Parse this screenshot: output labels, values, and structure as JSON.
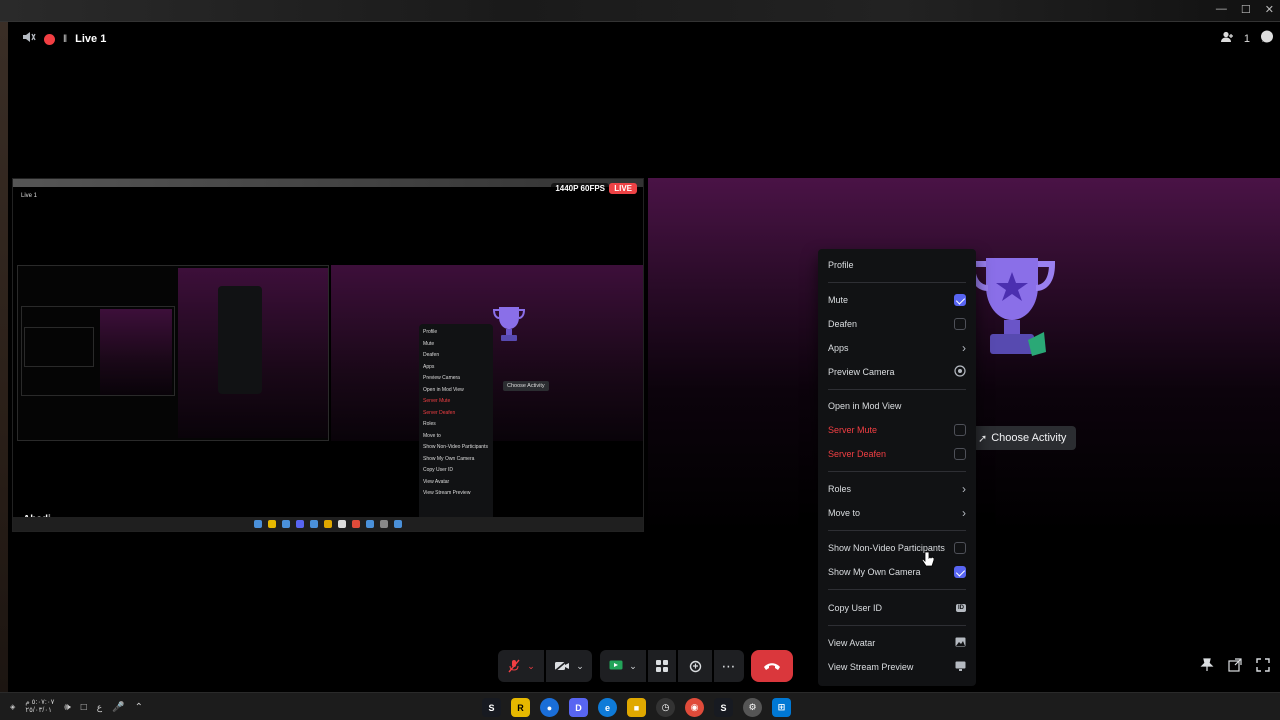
{
  "window": {
    "title": "Live 1",
    "participants_count": "1"
  },
  "left_tile": {
    "resolution_badge": "1440P 60FPS",
    "live_badge": "LIVE",
    "nested_title": "Live 1",
    "user_name": "Abadi",
    "nested_menu_items": [
      "Profile",
      "Mute",
      "Deafen",
      "Apps",
      "Preview Camera",
      "Open in Mod View",
      "Server Mute",
      "Server Deafen",
      "Roles",
      "Move to",
      "Show Non-Video Participants",
      "Show My Own Camera",
      "Copy User ID",
      "View Avatar",
      "View Stream Preview"
    ],
    "nested_choose_activity": "Choose Activity"
  },
  "right_tile": {
    "choose_activity": "Choose Activity"
  },
  "context_menu": {
    "profile": "Profile",
    "mute": "Mute",
    "deafen": "Deafen",
    "apps": "Apps",
    "preview_camera": "Preview Camera",
    "open_mod_view": "Open in Mod View",
    "server_mute": "Server Mute",
    "server_deafen": "Server Deafen",
    "roles": "Roles",
    "move_to": "Move to",
    "show_non_video": "Show Non-Video Participants",
    "show_own_camera": "Show My Own Camera",
    "copy_user_id": "Copy User ID",
    "view_avatar": "View Avatar",
    "view_stream_preview": "View Stream Preview",
    "checked": {
      "mute": true,
      "deafen": false,
      "server_mute": false,
      "server_deafen": false,
      "show_non_video": false,
      "show_own_camera": true
    }
  },
  "taskbar": {
    "clock_time": "٥:٠٧:٠٧ م",
    "clock_date": "٢٥/٠٣/٠١",
    "lang": "ع"
  },
  "colors": {
    "accent": "#5865f2",
    "danger": "#f23f43",
    "leave": "#da373c",
    "menu_bg": "#111214",
    "live": "#ed4245"
  }
}
